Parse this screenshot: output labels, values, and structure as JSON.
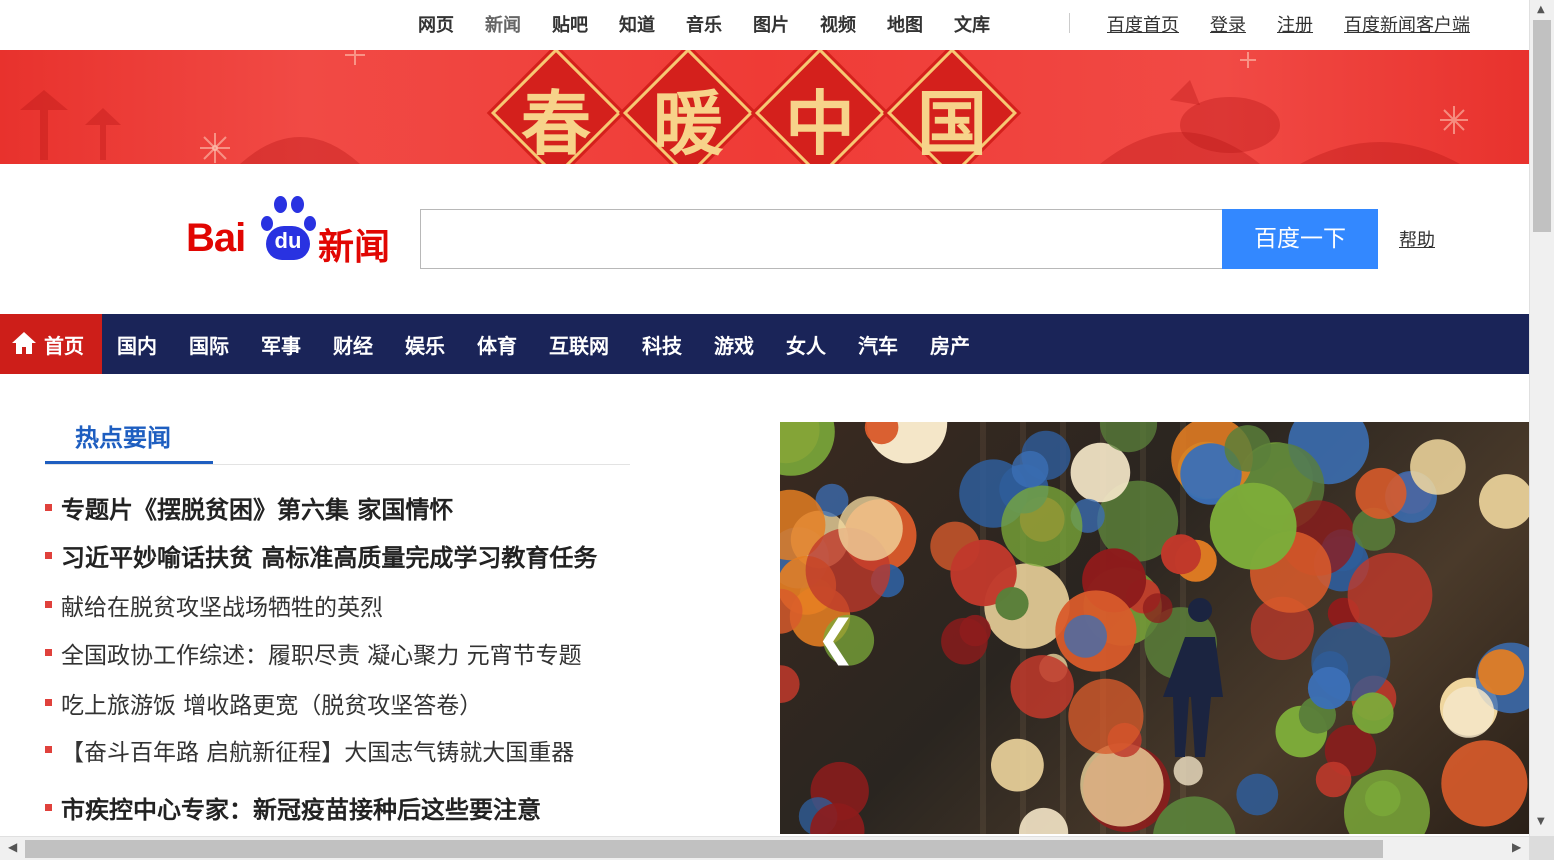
{
  "top_nav": {
    "items": [
      "网页",
      "新闻",
      "贴吧",
      "知道",
      "音乐",
      "图片",
      "视频",
      "地图",
      "文库"
    ],
    "links": [
      "百度首页",
      "登录",
      "注册",
      "百度新闻客户端"
    ]
  },
  "banner": {
    "chars": [
      "春",
      "暖",
      "中",
      "国"
    ]
  },
  "logo": {
    "bai": "Bai",
    "du": "du",
    "product": "新闻"
  },
  "search": {
    "value": "",
    "placeholder": "",
    "button_label": "百度一下",
    "help_label": "帮助"
  },
  "channel_nav": {
    "home_label": "首页",
    "items": [
      "国内",
      "国际",
      "军事",
      "财经",
      "娱乐",
      "体育",
      "互联网",
      "科技",
      "游戏",
      "女人",
      "汽车",
      "房产"
    ]
  },
  "hot_news": {
    "tab_label": "热点要闻",
    "items": [
      {
        "text": "专题片《摆脱贫困》第六集 家国情怀",
        "style": "big"
      },
      {
        "text": "习近平妙喻话扶贫  高标准高质量完成学习教育任务",
        "style": "big"
      },
      {
        "text": "献给在脱贫攻坚战场牺牲的英烈",
        "style": "norm"
      },
      {
        "text": "全国政协工作综述：履职尽责 凝心聚力  元宵节专题",
        "style": "norm"
      },
      {
        "text": "吃上旅游饭 增收路更宽（脱贫攻坚答卷）",
        "style": "norm"
      },
      {
        "text": "【奋斗百年路 启航新征程】大国志气铸就大国重器",
        "style": "norm"
      },
      {
        "text": "市疾控中心专家：新冠疫苗接种后这些要注意",
        "style": "big"
      }
    ]
  },
  "carousel": {
    "prev_label": "❮"
  },
  "colors": {
    "nav_bg": "#1a2458",
    "home_bg": "#cd1e19",
    "search_btn": "#3388ff",
    "logo_red": "#e10602",
    "logo_blue": "#2932e1",
    "banner_red": "#ef3b36",
    "hot_blue": "#1e5ec0"
  }
}
